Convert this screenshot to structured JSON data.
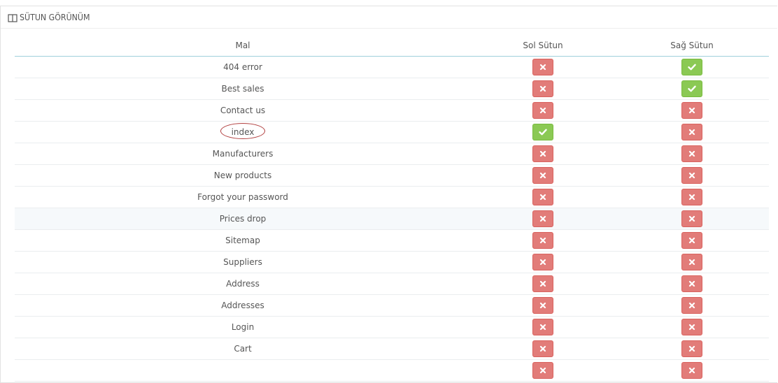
{
  "panel": {
    "title": "SÜTUN GÖRÜNÜM",
    "icon": "columns-icon"
  },
  "table": {
    "headers": [
      "Mal",
      "Sol Sütun",
      "Sağ Sütun"
    ],
    "rows": [
      {
        "name": "404 error",
        "left": false,
        "right": true
      },
      {
        "name": "Best sales",
        "left": false,
        "right": true
      },
      {
        "name": "Contact us",
        "left": false,
        "right": false
      },
      {
        "name": "index",
        "left": true,
        "right": false
      },
      {
        "name": "Manufacturers",
        "left": false,
        "right": false
      },
      {
        "name": "New products",
        "left": false,
        "right": false
      },
      {
        "name": "Forgot your password",
        "left": false,
        "right": false
      },
      {
        "name": "Prices drop",
        "left": false,
        "right": false
      },
      {
        "name": "Sitemap",
        "left": false,
        "right": false
      },
      {
        "name": "Suppliers",
        "left": false,
        "right": false
      },
      {
        "name": "Address",
        "left": false,
        "right": false
      },
      {
        "name": "Addresses",
        "left": false,
        "right": false
      },
      {
        "name": "Login",
        "left": false,
        "right": false
      },
      {
        "name": "Cart",
        "left": false,
        "right": false
      },
      {
        "name": "",
        "left": false,
        "right": false
      }
    ]
  },
  "highlighted_row": "index",
  "colors": {
    "enabled": "#8bc954",
    "disabled": "#e27c79",
    "header_border": "#a0d0dc",
    "annotation_ring": "#b24040"
  }
}
